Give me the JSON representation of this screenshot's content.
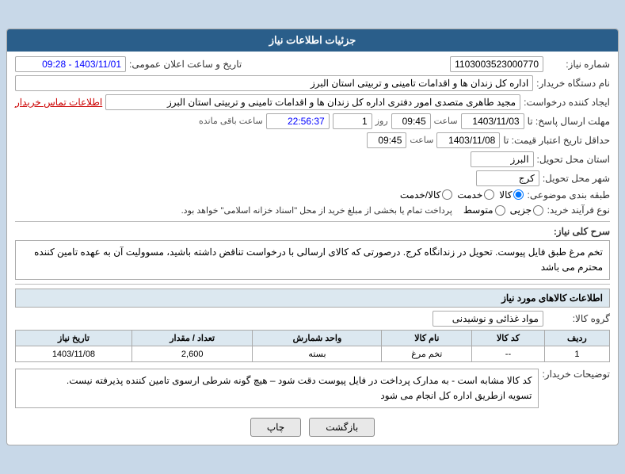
{
  "header": {
    "title": "جزئیات اطلاعات نیاز"
  },
  "fields": {
    "need_number_label": "شماره نیاز:",
    "need_number_value": "1103003523000770",
    "date_time_label": "تاریخ و ساعت اعلان عمومی:",
    "date_time_value": "1403/11/01 - 09:28",
    "buyer_org_label": "نام دستگاه خریدار:",
    "buyer_org_value": "اداره کل زندان ها و اقدامات تامینی و تربیتی استان البرز",
    "requester_label": "ایجاد کننده درخواست:",
    "requester_value": "مجید طاهری متصدی امور دفتری اداره کل زندان ها و اقدامات تامینی و تربیتی استان البرز",
    "contact_label": "اطلاعات تماس خریدار",
    "response_deadline_label": "مهلت ارسال پاسخ: تا",
    "response_date": "1403/11/03",
    "response_time": "09:45",
    "response_day": "1",
    "response_remaining": "22:56:37",
    "response_remaining_label": "ساعت باقی مانده",
    "price_deadline_label": "حداقل تاریخ اعتبار قیمت: تا",
    "price_date": "1403/11/08",
    "price_time": "09:45",
    "province_label": "استان محل تحویل:",
    "province_value": "البرز",
    "city_label": "شهر محل تحویل:",
    "city_value": "کرج",
    "type_label": "طبقه بندی موضوعی:",
    "type_options": [
      "کالا",
      "خدمت",
      "کالا/خدمت"
    ],
    "type_selected": "کالا",
    "purchase_type_label": "نوع فرآیند خرید:",
    "purchase_options": [
      "جزیی",
      "متوسط"
    ],
    "purchase_notice": "پرداخت تمام یا بخشی از مبلغ خرید از محل \"اسناد خزانه اسلامی\" خواهد بود.",
    "need_desc_label": "سرح کلی نیاز:",
    "need_desc_text": "تخم مرغ طبق فایل پیوست. تحویل در زندانگاه کرج. درصورتی که کالای ارسالی با درخواست تناقض داشته باشید، مسوولیت آن به عهده تامین کننده محترم می باشد",
    "goods_info_title": "اطلاعات کالاهای مورد نیاز",
    "goods_group_label": "گروه کالا:",
    "goods_group_value": "مواد غذائی و نوشیدنی",
    "table": {
      "headers": [
        "ردیف",
        "کد کالا",
        "نام کالا",
        "واحد شمارش",
        "تعداد / مقدار",
        "تاریخ نیاز"
      ],
      "rows": [
        [
          "1",
          "--",
          "تخم مرغ",
          "بسته",
          "2,600",
          "1403/11/08"
        ]
      ]
    },
    "buyer_notes_label": "توضیحات خریدار:",
    "buyer_notes_text1": "کد کالا مشابه است - به مدارک پرداخت در فایل پیوست دقت شود – هیچ گونه شرطی ارسوی تامین کننده پذیرفته نیست.",
    "buyer_notes_text2": "تسویه ازطریق اداره کل انجام می شود",
    "btn_print": "چاپ",
    "btn_back": "بازگشت"
  }
}
